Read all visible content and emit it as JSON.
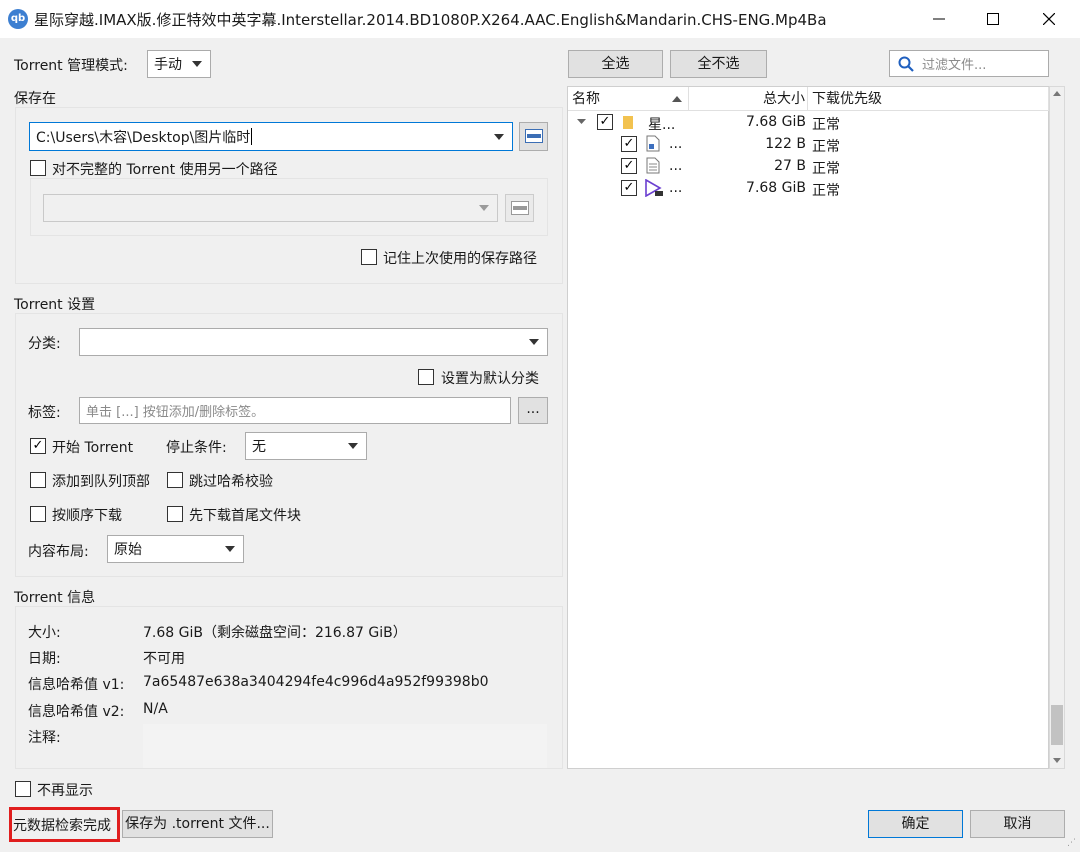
{
  "window": {
    "app_icon_text": "qb",
    "title": "星际穿越.IMAX版.修正特效中英字幕.Interstellar.2014.BD1080P.X264.AAC.English&Mandarin.CHS-ENG.Mp4Ba"
  },
  "left": {
    "mgmt_label": "Torrent 管理模式:",
    "mgmt_value": "手动",
    "save_section": "保存在",
    "save_path": "C:\\Users\\木容\\Desktop\\图片临时",
    "alt_path_checkbox": "对不完整的 Torrent 使用另一个路径",
    "remember_checkbox": "记住上次使用的保存路径",
    "settings_section": "Torrent 设置",
    "category_label": "分类:",
    "default_category_checkbox": "设置为默认分类",
    "tags_label": "标签:",
    "tags_placeholder": "单击 [...] 按钮添加/删除标签。",
    "tags_button": "...",
    "start_torrent": "开始 Torrent",
    "stop_condition_label": "停止条件:",
    "stop_condition_value": "无",
    "add_top_queue": "添加到队列顶部",
    "skip_hash": "跳过哈希校验",
    "sequential": "按顺序下载",
    "first_last": "先下载首尾文件块",
    "layout_label": "内容布局:",
    "layout_value": "原始",
    "info_section": "Torrent 信息",
    "info": {
      "size_label": "大小:",
      "size_value": "7.68 GiB（剩余磁盘空间：216.87 GiB）",
      "date_label": "日期:",
      "date_value": "不可用",
      "hash1_label": "信息哈希值 v1:",
      "hash1_value": "7a65487e638a3404294fe4c996d4a952f99398b0",
      "hash2_label": "信息哈希值 v2:",
      "hash2_value": "N/A",
      "comment_label": "注释:"
    }
  },
  "right": {
    "select_all": "全选",
    "select_none": "全不选",
    "filter_placeholder": "过滤文件...",
    "columns": {
      "name": "名称",
      "size": "总大小",
      "priority": "下载优先级"
    },
    "rows": [
      {
        "name": "星...",
        "size": "7.68 GiB",
        "priority": "正常"
      },
      {
        "name": "...",
        "size": "122 B",
        "priority": "正常"
      },
      {
        "name": "...",
        "size": "27 B",
        "priority": "正常"
      },
      {
        "name": "...",
        "size": "7.68 GiB",
        "priority": "正常"
      }
    ]
  },
  "footer": {
    "dont_show": "不再显示",
    "metadata_status": "元数据检索完成",
    "save_torrent": "保存为 .torrent 文件...",
    "ok": "确定",
    "cancel": "取消"
  },
  "colors": {
    "highlight_border": "#e01e1e",
    "accent": "#0078d7"
  }
}
